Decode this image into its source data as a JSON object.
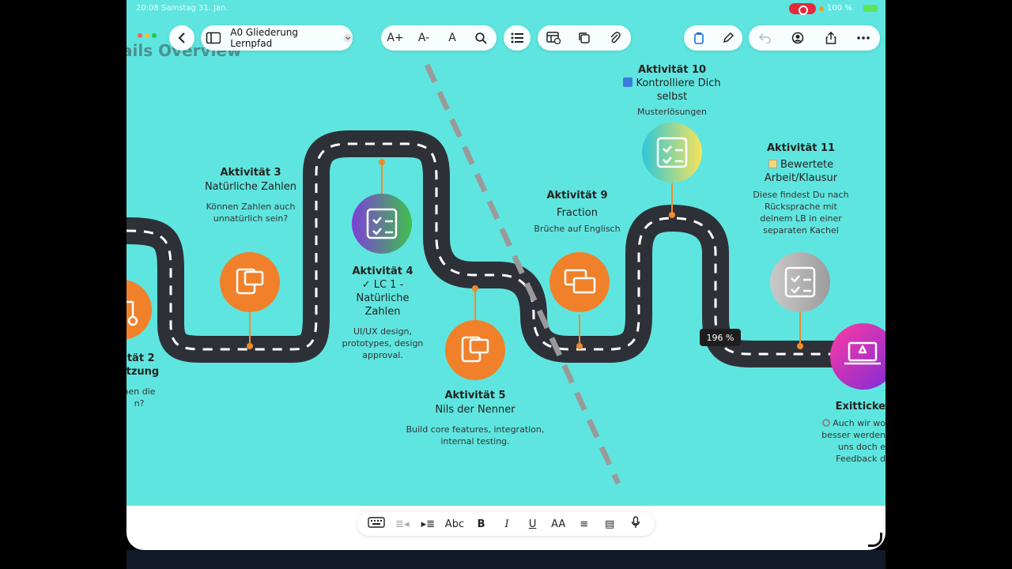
{
  "status": {
    "left": "20:08  Samstag 31. Jan.",
    "battery": "100 %"
  },
  "doc": {
    "title": "A0 Gliederung Lernpfad",
    "behind": "ails Overview"
  },
  "toolbar": {
    "font_up": "A+",
    "font_down": "A-",
    "font_style": "A"
  },
  "zoom": "196 %",
  "activities": {
    "a2": {
      "h": "ität 2",
      "sub": "etzung",
      "d1": "nen die",
      "d2": "n?"
    },
    "a3": {
      "h": "Aktivität 3",
      "sub": "Natürliche Zahlen",
      "d1": "Können Zahlen auch",
      "d2": "unnatürlich sein?"
    },
    "a4": {
      "h": "Aktivität 4",
      "sub1": "✓ LC 1 -",
      "sub2": "Natürliche",
      "sub3": "Zahlen",
      "d1": "UI/UX design,",
      "d2": "prototypes, design",
      "d3": "approval."
    },
    "a5": {
      "h": "Aktivität 5",
      "sub": "Nils der Nenner",
      "d1": "Build core features, integration,",
      "d2": "internal testing."
    },
    "a9": {
      "h": "Aktivität 9",
      "sub": "Fraction",
      "d1": "Brüche auf Englisch"
    },
    "a10": {
      "h": "Aktivität 10",
      "sub1": "Kontrolliere Dich",
      "sub2": "selbst",
      "d1": "Musterlösungen"
    },
    "a11": {
      "h": "Aktivität 11",
      "sub1": "Bewertete",
      "sub2": "Arbeit/Klausur",
      "d1": "Diese findest Du nach",
      "d2": "Rücksprache mit",
      "d3": "deinem LB in einer",
      "d4": "separaten Kachel"
    },
    "exit": {
      "h": "Exitticke",
      "d1": "Auch wir wo",
      "d2": "besser werden",
      "d3": "uns doch e",
      "d4": "Feedback d"
    }
  },
  "kbbar": {
    "abc": "Abc",
    "bold": "B",
    "italic": "I",
    "underline": "U",
    "size": "AA"
  },
  "colors": {
    "canvas": "#5fe5df",
    "road": "#2e3038",
    "orange": "#f0812a",
    "connector": "#f08a2a"
  }
}
